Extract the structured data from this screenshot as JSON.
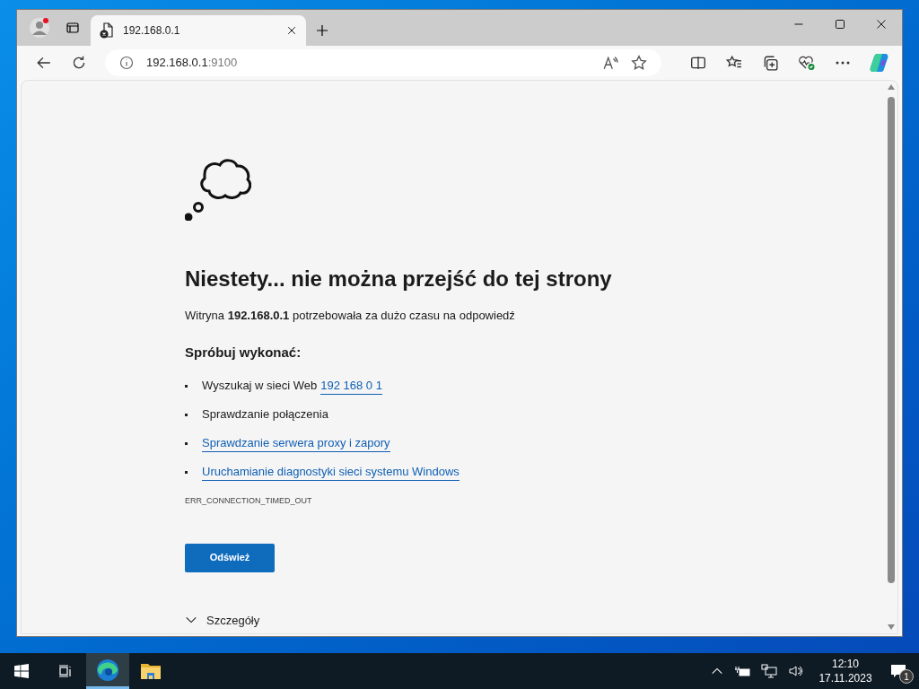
{
  "browser": {
    "tabs": [
      {
        "title": "192.168.0.1",
        "selected": true
      }
    ],
    "address": {
      "host": "192.168.0.1",
      "port": ":9100"
    }
  },
  "page": {
    "heading": "Niestety... nie można przejść do tej strony",
    "message": "Witryna **192.168.0.1** potrzebowała za dużo czasu na odpowiedź",
    "suggestions_title": "Spróbuj wykonać:",
    "suggestions": [
      {
        "kind": "text_link",
        "text": "Wyszukaj w sieci Web",
        "link": "192 168 0 1"
      },
      {
        "kind": "text",
        "text": "Sprawdzanie połączenia"
      },
      {
        "kind": "link",
        "text": "Sprawdzanie serwera proxy i zapory"
      },
      {
        "kind": "link",
        "text": "Uruchamianie diagnostyki sieci systemu Windows"
      }
    ],
    "error_code": "ERR_CONNECTION_TIMED_OUT",
    "button": "Odśwież",
    "details": "Szczegóły"
  },
  "taskbar": {
    "time": "12:10",
    "date": "17.11.2023",
    "notifications": "1"
  }
}
